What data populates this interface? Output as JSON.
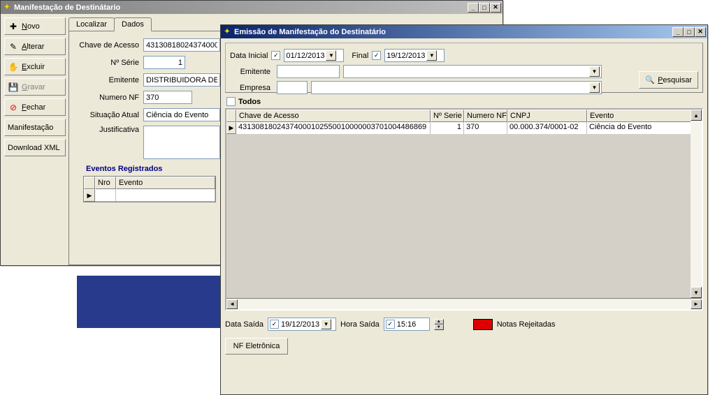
{
  "main_window": {
    "title": "Manifestação de Destinátario",
    "buttons": {
      "novo": "Novo",
      "alterar": "Alterar",
      "excluir": "Excluir",
      "gravar": "Gravar",
      "fechar": "Fechar",
      "manifestacao": "Manifestação",
      "download": "Download XML"
    },
    "tabs": {
      "localizar": "Localizar",
      "dados": "Dados"
    },
    "form": {
      "chave_label": "Chave de Acesso",
      "chave_value": "43130818024374000",
      "serie_label": "Nº Série",
      "serie_value": "1",
      "emitente_label": "Emitente",
      "emitente_value": "DISTRIBUIDORA DE",
      "numero_label": "Numero NF",
      "numero_value": "370",
      "situacao_label": "Situação Atual",
      "situacao_value": "Ciência do Evento",
      "justificativa_label": "Justificativa",
      "justificativa_value": ""
    },
    "eventos": {
      "title": "Eventos Registrados",
      "cols": {
        "nro": "Nro",
        "evento": "Evento"
      }
    }
  },
  "popup": {
    "title": "Emissão de Manifestação do Destinatário",
    "filters": {
      "data_inicial_label": "Data Inicial",
      "data_inicial_value": "01/12/2013",
      "final_label": "Final",
      "final_value": "19/12/2013",
      "emitente_label": "Emitente",
      "emitente_code": "",
      "emitente_name": "",
      "empresa_label": "Empresa",
      "empresa_code": "",
      "empresa_name": "",
      "pesquisar": "Pesquisar"
    },
    "todos_label": "Todos",
    "grid": {
      "cols": {
        "chave": "Chave de Acesso",
        "serie": "Nº Serie",
        "numero": "Numero NF",
        "cnpj": "CNPJ",
        "evento": "Evento"
      },
      "rows": [
        {
          "chave": "43130818024374000102550010000003701004486869",
          "serie": "1",
          "numero": "370",
          "cnpj": "00.000.374/0001-02",
          "evento": "Ciência do Evento"
        }
      ]
    },
    "footer": {
      "data_saida_label": "Data Saída",
      "data_saida_value": "19/12/2013",
      "hora_saida_label": "Hora Saída",
      "hora_saida_value": "15:16",
      "notas_rejeitadas": "Notas Rejeitadas",
      "nf_button": "NF Eletrônica"
    }
  }
}
